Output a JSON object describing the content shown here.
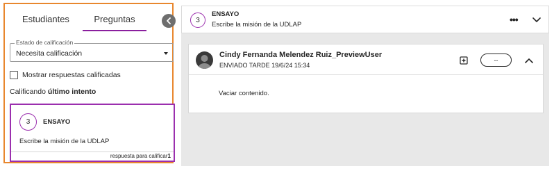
{
  "left_panel": {
    "tabs": [
      {
        "label": "Estudiantes"
      },
      {
        "label": "Preguntas"
      }
    ],
    "grade_status": {
      "label": "Estado de calificación",
      "value": "Necesita calificación"
    },
    "show_graded_label": "Mostrar respuestas calificadas",
    "grading_prefix": "Calificando ",
    "grading_bold": "último intento",
    "question_card": {
      "number": "3",
      "type": "ENSAYO",
      "text": "Escribe la misión de la UDLAP",
      "footer_text": "respuesta para calificar",
      "footer_count": "1"
    }
  },
  "right_panel": {
    "header": {
      "number": "3",
      "type": "ENSAYO",
      "text": "Escribe la misión de la UDLAP"
    },
    "response": {
      "user_name": "Cindy Fernanda Melendez Ruiz_PreviewUser",
      "submitted": "ENVIADO TARDE 19/6/24 15:34",
      "score": "--",
      "content": "Vaciar contenido."
    }
  },
  "colors": {
    "panel_border": "#e8872e",
    "accent_purple": "#9b2fae",
    "background_gray": "#e8e8e8"
  },
  "icons": [
    "chevron-left-icon",
    "caret-down-icon",
    "more-horizontal-icon",
    "chevron-down-icon",
    "chevron-up-icon",
    "add-feedback-icon",
    "user-avatar"
  ]
}
